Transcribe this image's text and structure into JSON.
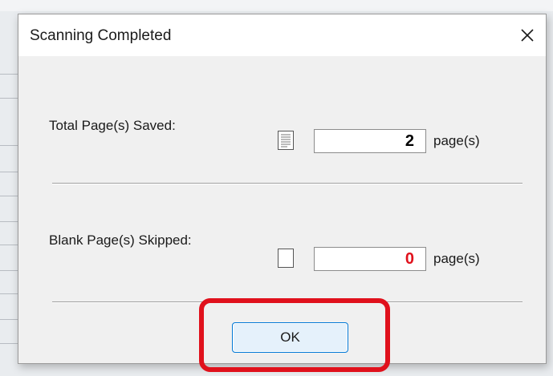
{
  "dialog": {
    "title": "Scanning Completed",
    "close_icon": "close-icon"
  },
  "saved": {
    "label": "Total Page(s) Saved:",
    "icon": "document-page-icon",
    "value": "2",
    "value_color": "#000000",
    "unit": "page(s)"
  },
  "skipped": {
    "label": "Blank Page(s) Skipped:",
    "icon": "blank-page-icon",
    "value": "0",
    "value_color": "#e0111c",
    "unit": "page(s)"
  },
  "ok_button": {
    "label": "OK"
  },
  "annotation": {
    "highlight_color": "#e0111c"
  }
}
